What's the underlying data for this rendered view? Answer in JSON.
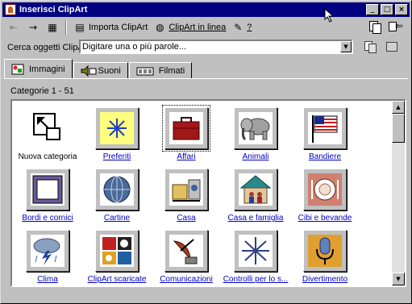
{
  "window": {
    "title": "Inserisci ClipArt"
  },
  "toolbar": {
    "import_label": "Importa ClipArt",
    "online_label": "ClipArt in linea",
    "help_label": "?"
  },
  "search": {
    "label": "Cerca oggetti ClipArt:",
    "value": "Digitare una o più parole..."
  },
  "tabs": [
    {
      "label": "Immagini",
      "active": true
    },
    {
      "label": "Suoni",
      "active": false
    },
    {
      "label": "Filmati",
      "active": false
    }
  ],
  "categories_label": "Categorie 1 - 51",
  "categories": [
    {
      "label": "Nuova categoria",
      "icon": "new-category-icon"
    },
    {
      "label": "Preferiti",
      "icon": "favorites-icon"
    },
    {
      "label": "Affari",
      "icon": "briefcase-icon"
    },
    {
      "label": "Animali",
      "icon": "elephant-icon"
    },
    {
      "label": "Bandiere",
      "icon": "flag-icon"
    },
    {
      "label": "Bordi e cornici",
      "icon": "frame-icon"
    },
    {
      "label": "Cartine",
      "icon": "globe-icon"
    },
    {
      "label": "Casa",
      "icon": "home-appliances-icon"
    },
    {
      "label": "Casa e famiglia",
      "icon": "family-house-icon"
    },
    {
      "label": "Cibi e bevande",
      "icon": "plate-icon"
    },
    {
      "label": "Clima",
      "icon": "storm-cloud-icon"
    },
    {
      "label": "ClipArt scaricate",
      "icon": "downloaded-clipart-icon"
    },
    {
      "label": "Comunicazioni",
      "icon": "satellite-dish-icon"
    },
    {
      "label": "Controlli per lo s...",
      "icon": "compass-star-icon"
    },
    {
      "label": "Divertimento",
      "icon": "microphone-icon"
    }
  ],
  "colors": {
    "titlebar": "#000080",
    "link": "#0000c0",
    "face": "#c0c0c0"
  }
}
